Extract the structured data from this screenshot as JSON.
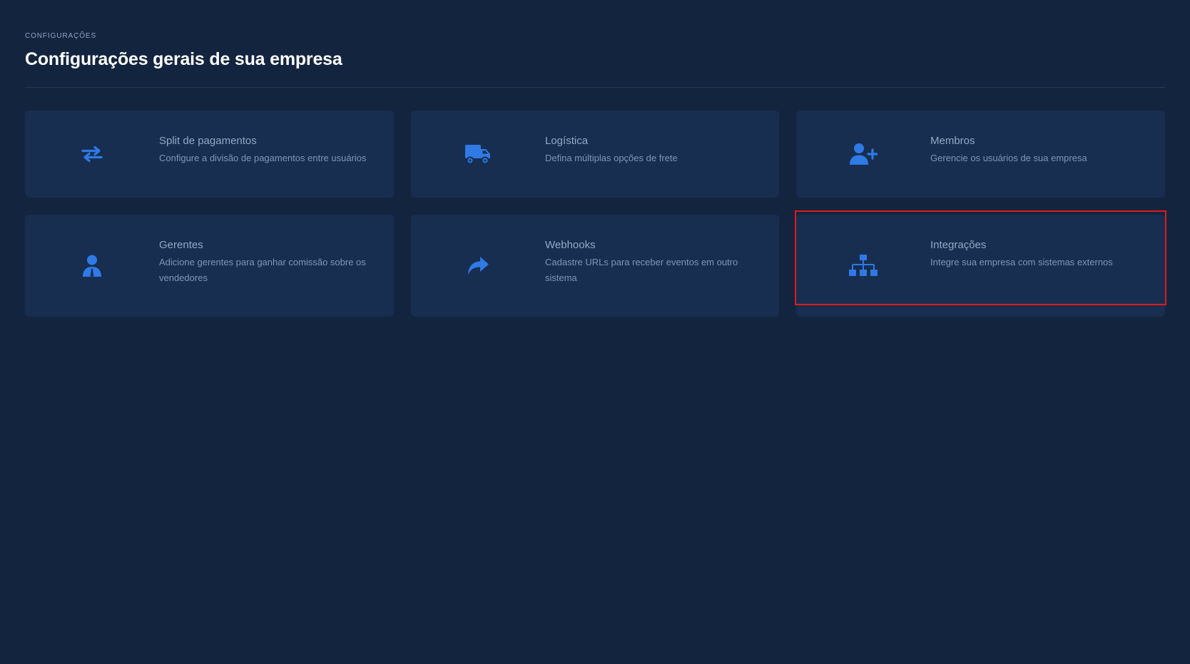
{
  "header": {
    "eyebrow": "CONFIGURAÇÕES",
    "title": "Configurações gerais de sua empresa"
  },
  "colors": {
    "background": "#13243e",
    "card": "#172e51",
    "accent": "#2f7ae5",
    "highlight": "#e01b1b"
  },
  "cards": [
    {
      "title": "Split de pagamentos",
      "description": "Configure a divisão de pagamentos entre usuários",
      "icon": "exchange-arrows-icon"
    },
    {
      "title": "Logística",
      "description": "Defina múltiplas opções de frete",
      "icon": "truck-icon"
    },
    {
      "title": "Membros",
      "description": "Gerencie os usuários de sua empresa",
      "icon": "user-plus-icon"
    },
    {
      "title": "Gerentes",
      "description": "Adicione gerentes para ganhar comissão sobre os vendedores",
      "icon": "user-tie-icon"
    },
    {
      "title": "Webhooks",
      "description": "Cadastre URLs para receber eventos em outro sistema",
      "icon": "share-arrow-icon"
    },
    {
      "title": "Integrações",
      "description": "Integre sua empresa com sistemas externos",
      "icon": "sitemap-icon"
    }
  ]
}
